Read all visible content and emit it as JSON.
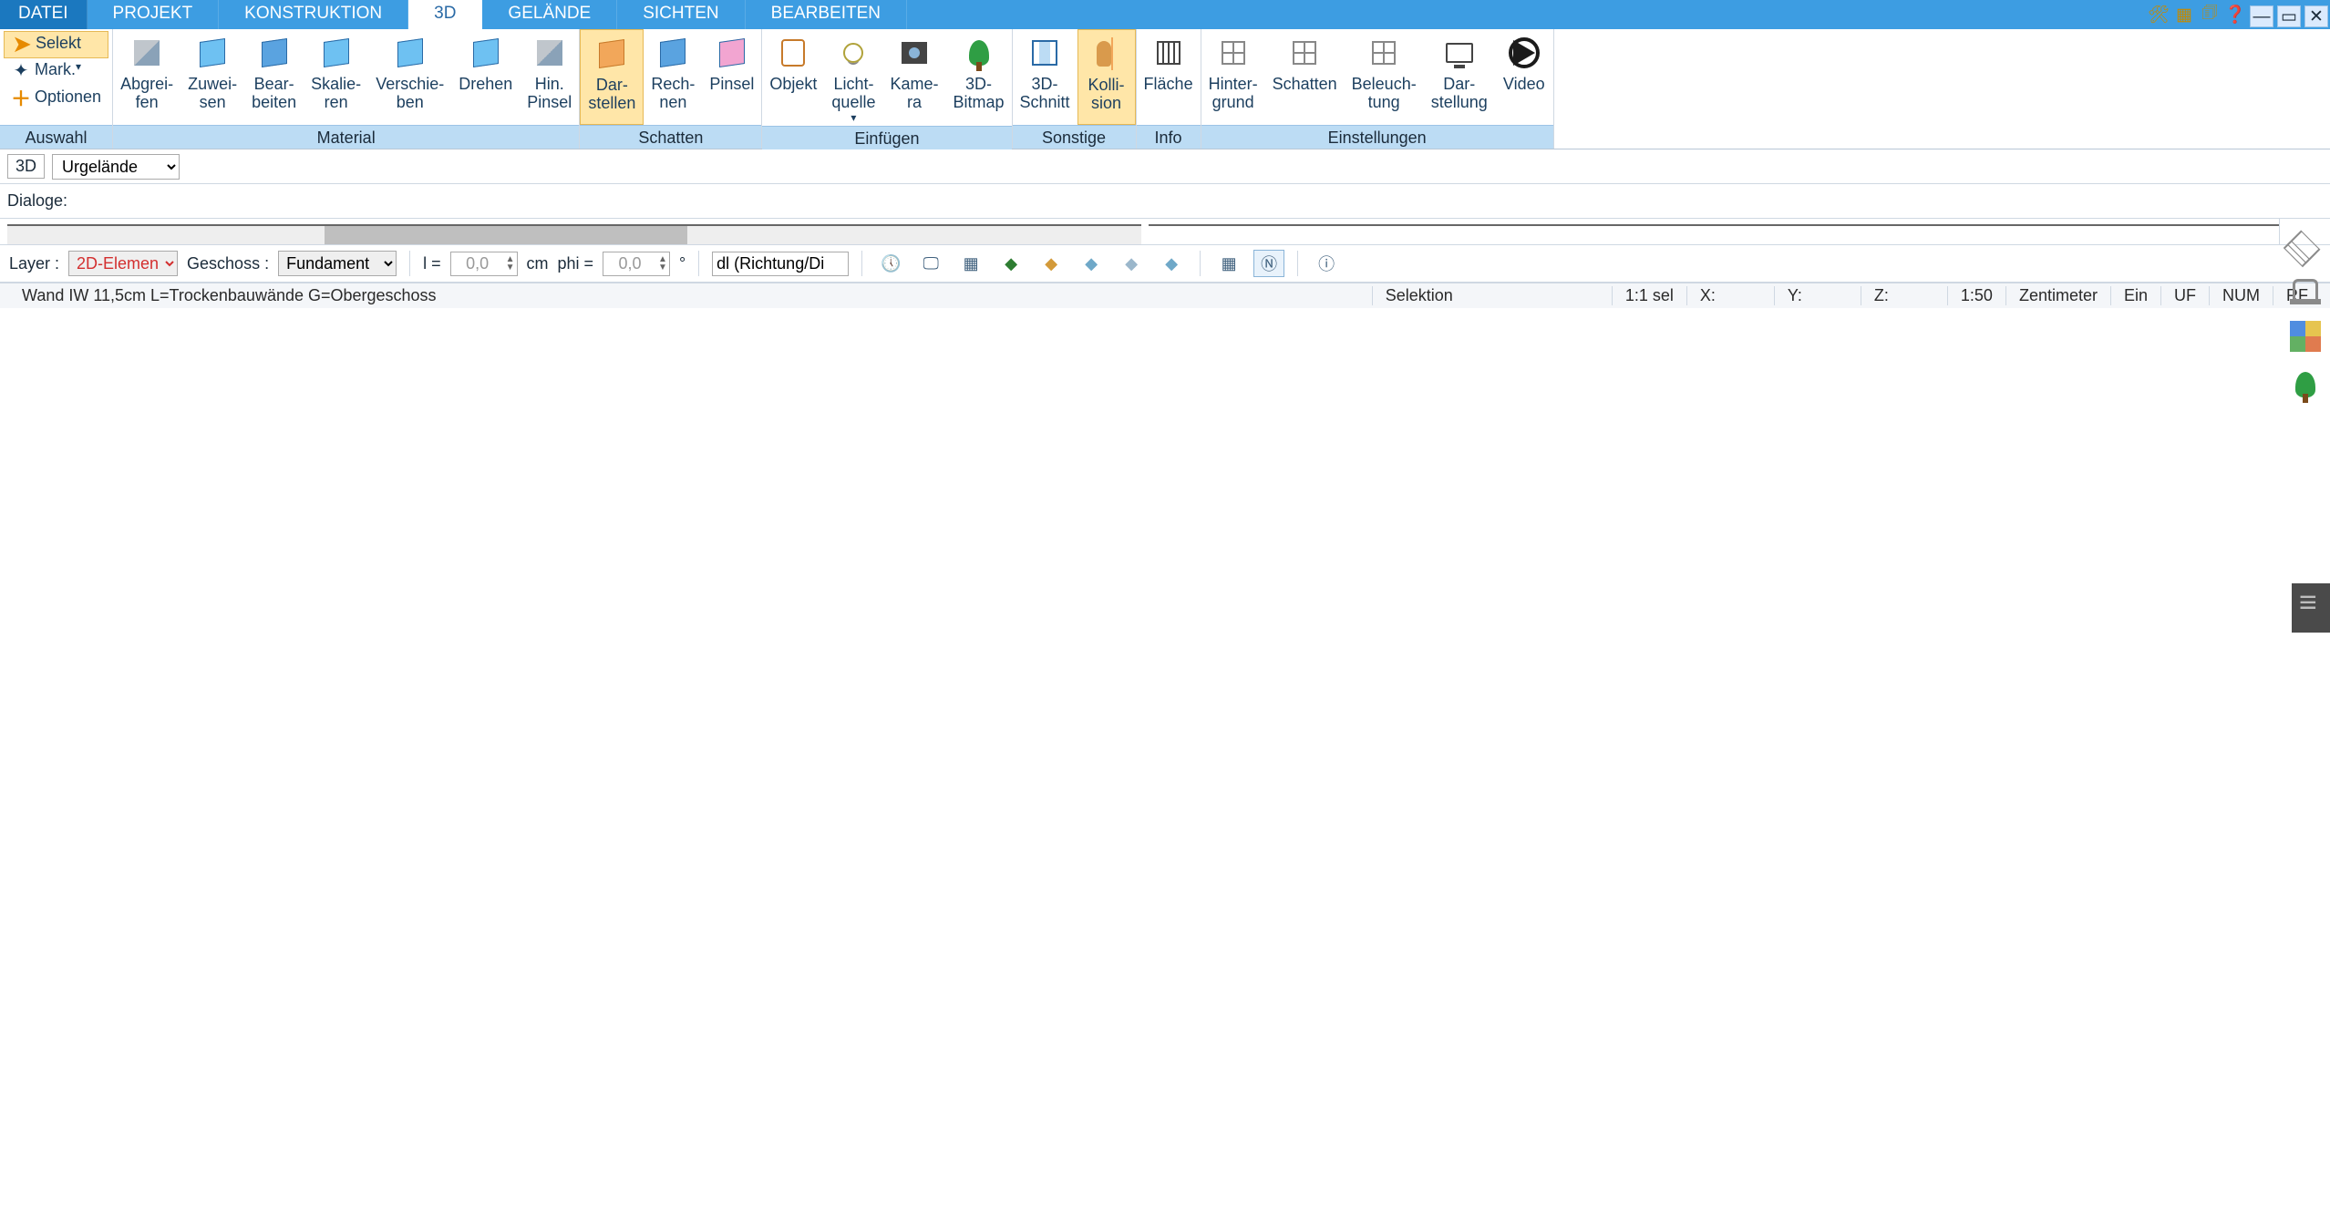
{
  "menu": {
    "file": "DATEI",
    "tabs": [
      "PROJEKT",
      "KONSTRUKTION",
      "3D",
      "GELÄNDE",
      "SICHTEN",
      "BEARBEITEN"
    ],
    "active": 2
  },
  "ribbon": {
    "groups": {
      "auswahl": {
        "title": "Auswahl",
        "selekt": "Selekt",
        "mark": "Mark.",
        "optionen": "Optionen"
      },
      "material": {
        "title": "Material",
        "abgreifen": "Abgrei-\nfen",
        "zuweisen": "Zuwei-\nsen",
        "bearbeiten": "Bear-\nbeiten",
        "skalieren": "Skalie-\nren",
        "verschieben": "Verschie-\nben",
        "drehen": "Drehen",
        "hinpinsel": "Hin.\nPinsel"
      },
      "schatten": {
        "title": "Schatten",
        "darstellen": "Dar-\nstellen",
        "rechnen": "Rech-\nnen",
        "pinsel": "Pinsel"
      },
      "einfuegen": {
        "title": "Einfügen",
        "objekt": "Objekt",
        "lichtquelle": "Licht-\nquelle",
        "kamera": "Kame-\nra",
        "bitmap": "3D-\nBitmap"
      },
      "sonstige": {
        "title": "Sonstige",
        "schnitt": "3D-\nSchnitt",
        "kollision": "Kolli-\nsion"
      },
      "info": {
        "title": "Info",
        "flaeche": "Fläche"
      },
      "einstellungen": {
        "title": "Einstellungen",
        "hintergrund": "Hinter-\ngrund",
        "schatten": "Schatten",
        "beleuchtung": "Beleuch-\ntung",
        "darstellung": "Dar-\nstellung",
        "video": "Video"
      }
    }
  },
  "subbar": {
    "view": "3D",
    "layer": "Urgelände"
  },
  "dialoge": "Dialoge:",
  "bottom": {
    "layer_lbl": "Layer :",
    "layer_val": "2D-Elemen",
    "geschoss_lbl": "Geschoss :",
    "geschoss_val": "Fundament",
    "l_lbl": "l =",
    "l_val": "0,0",
    "l_unit": "cm",
    "phi_lbl": "phi =",
    "phi_val": "0,0",
    "phi_unit": "°",
    "dl": "dl (Richtung/Di"
  },
  "status": {
    "hint": "Wand IW 11,5cm L=Trockenbauwände G=Obergeschoss",
    "selektion": "Selektion",
    "sel": "1:1 sel",
    "x": "X:",
    "y": "Y:",
    "z": "Z:",
    "scale": "1:50",
    "unit": "Zentimeter",
    "ein": "Ein",
    "uf": "UF",
    "num": "NUM",
    "rf": "RF"
  }
}
